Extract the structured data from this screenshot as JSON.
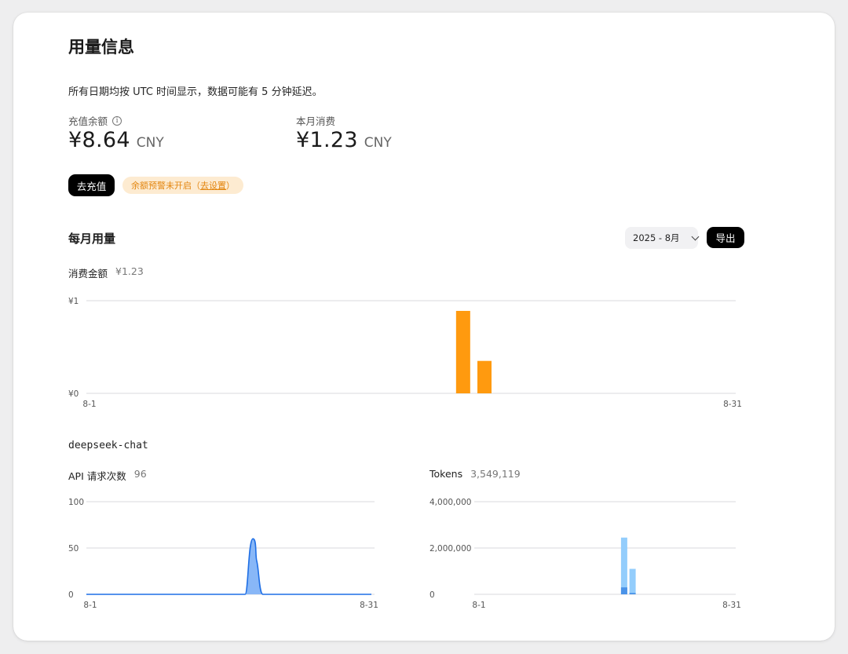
{
  "header": {
    "title": "用量信息",
    "note": "所有日期均按 UTC 时间显示，数据可能有 5 分钟延迟。"
  },
  "balance": {
    "label": "充值余额",
    "info_icon": "info-icon",
    "amount": "¥8.64",
    "unit": "CNY"
  },
  "month_spend": {
    "label": "本月消费",
    "amount": "¥1.23",
    "unit": "CNY"
  },
  "actions": {
    "topup_label": "去充值",
    "warning_text": "余额预警未开启（",
    "warning_link": "去设置",
    "warning_suffix": "）"
  },
  "monthly": {
    "title": "每月用量",
    "month_select": "2025 - 8月",
    "export_label": "导出"
  },
  "spend_chart": {
    "metric_label": "消费金额",
    "metric_value": "¥1.23"
  },
  "model": {
    "name": "deepseek-chat",
    "api_label": "API 请求次数",
    "api_value": "96",
    "tokens_label": "Tokens",
    "tokens_value": "3,549,119"
  },
  "colors": {
    "spend_bar": "#ff9a0f",
    "requests_line": "#1f6fe5",
    "requests_fill": "#88b7f7",
    "tokens_light": "#93cdfc",
    "tokens_dark": "#4a93e8",
    "warning_bg": "#fdebd1",
    "warning_text": "#e3860f"
  },
  "chart_data": [
    {
      "type": "bar",
      "x_start": "8-1",
      "x_end": "8-31",
      "y_ticks": [
        "¥0",
        "¥1"
      ],
      "ylim": [
        0,
        1
      ],
      "series": [
        {
          "points": [
            [
              18,
              0.89
            ],
            [
              19,
              0.35
            ]
          ]
        }
      ]
    },
    {
      "type": "area",
      "x_start": "8-1",
      "x_end": "8-31",
      "y_ticks": [
        "0",
        "50",
        "100"
      ],
      "ylim": [
        0,
        100
      ],
      "series": [
        {
          "points": [
            [
              18,
              60
            ],
            [
              19,
              36
            ]
          ]
        }
      ]
    },
    {
      "type": "bar",
      "x_start": "8-1",
      "x_end": "8-31",
      "y_ticks": [
        "0",
        "2,000,000",
        "4,000,000"
      ],
      "ylim": [
        0,
        4000000
      ],
      "series": [
        {
          "points": [
            [
              18,
              2450000
            ],
            [
              19,
              1100000
            ]
          ],
          "color_key": "tokens_light"
        },
        {
          "points": [
            [
              18,
              300000
            ],
            [
              19,
              60000
            ]
          ],
          "color_key": "tokens_dark"
        }
      ]
    }
  ]
}
